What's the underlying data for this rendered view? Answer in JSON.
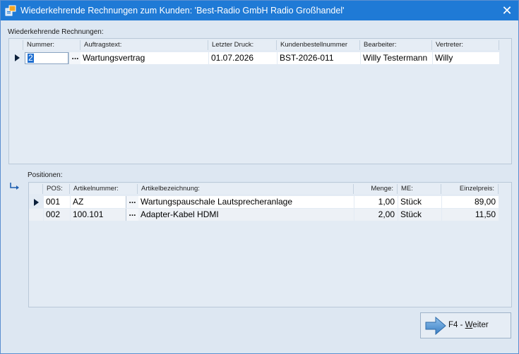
{
  "window": {
    "title": "Wiederkehrende Rechnungen zum Kunden: 'Best-Radio GmbH Radio Großhandel'",
    "close_glyph": "✕"
  },
  "recurring": {
    "label": "Wiederkehrende Rechnungen:",
    "columns": [
      "Nummer:",
      "Auftragstext:",
      "Letzter Druck:",
      "Kundenbestellnummer",
      "Bearbeiter:",
      "Vertreter:"
    ],
    "row": {
      "nummer": "2",
      "auftragstext": "Wartungsvertrag",
      "letzter_druck": "01.07.2026",
      "kundenbestellnummer": "BST-2026-011",
      "bearbeiter": "Willy Testermann",
      "vertreter": "Willy"
    }
  },
  "positions": {
    "label": "Positionen:",
    "columns": [
      "POS:",
      "Artikelnummer:",
      "Artikelbezeichnung:",
      "Menge:",
      "ME:",
      "Einzelpreis:"
    ],
    "rows": [
      {
        "pos": "001",
        "artikelnummer": "AZ",
        "bezeichnung": "Wartungspauschale Lautsprecheranlage",
        "menge": "1,00",
        "me": "Stück",
        "preis": "89,00"
      },
      {
        "pos": "002",
        "artikelnummer": "100.101",
        "bezeichnung": "Adapter-Kabel HDMI",
        "menge": "2,00",
        "me": "Stück",
        "preis": "11,50"
      }
    ]
  },
  "lookup_glyph": "...",
  "button": {
    "key": "F4 - ",
    "mnemonic": "W",
    "rest": "eiter"
  },
  "icons": {
    "app": "app-icon",
    "close": "close-icon",
    "row_indicator": "row-indicator-icon",
    "child_link": "child-link-arrow-icon",
    "next": "arrow-right-icon"
  },
  "colors": {
    "titlebar": "#1f7ad6",
    "selection": "#1f6fd1",
    "background": "#dde7f2"
  }
}
